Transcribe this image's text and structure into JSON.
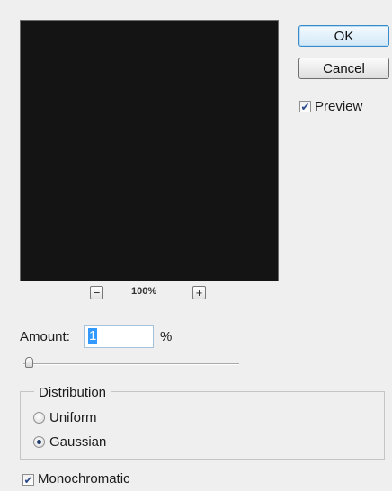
{
  "dialog": {
    "ok_label": "OK",
    "cancel_label": "Cancel",
    "preview_label": "Preview",
    "preview_checked": true
  },
  "zoom": {
    "minus": "−",
    "plus": "+",
    "level": "100%"
  },
  "amount": {
    "label": "Amount:",
    "value": "1",
    "unit": "%",
    "slider_fraction": 0.01
  },
  "distribution": {
    "legend": "Distribution",
    "options": [
      {
        "label": "Uniform",
        "selected": false
      },
      {
        "label": "Gaussian",
        "selected": true
      }
    ]
  },
  "monochromatic": {
    "label": "Monochromatic",
    "checked": true
  },
  "icons": {
    "checkmark": "✔"
  },
  "colors": {
    "preview_bg": "#141414",
    "selection": "#3399ff",
    "default_button_border": "#3a8bc8"
  }
}
